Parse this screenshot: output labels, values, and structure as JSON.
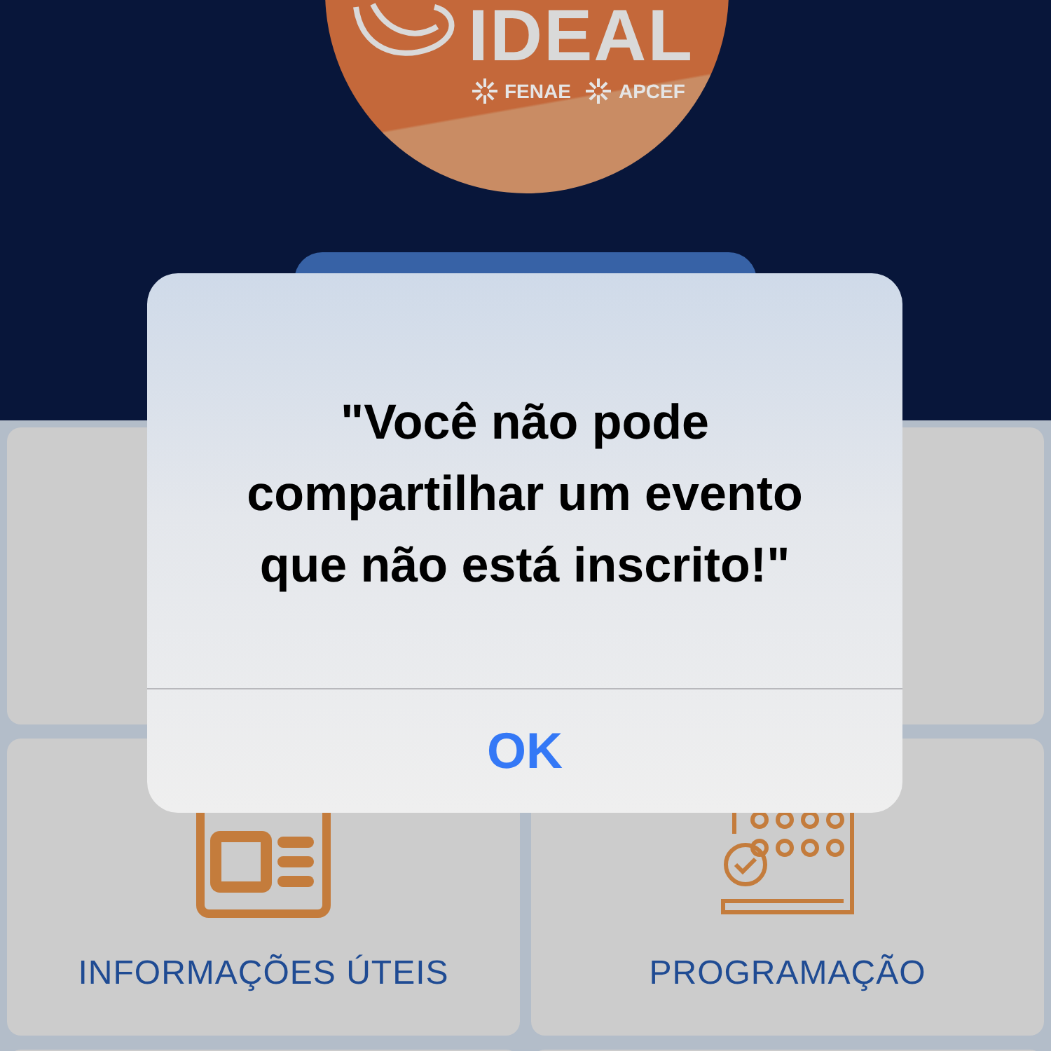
{
  "logo": {
    "title": "IDEAL",
    "partners": [
      "FENAE",
      "APCEF"
    ]
  },
  "tiles": [
    {
      "kind": "blank"
    },
    {
      "kind": "blank"
    },
    {
      "kind": "info",
      "label": "INFORMAÇÕES ÚTEIS"
    },
    {
      "kind": "schedule",
      "label": "PROGRAMAÇÃO"
    }
  ],
  "dialog": {
    "message": "\"Você não pode compartilhar um evento que não está inscrito!\"",
    "buttons": [
      "OK"
    ]
  }
}
